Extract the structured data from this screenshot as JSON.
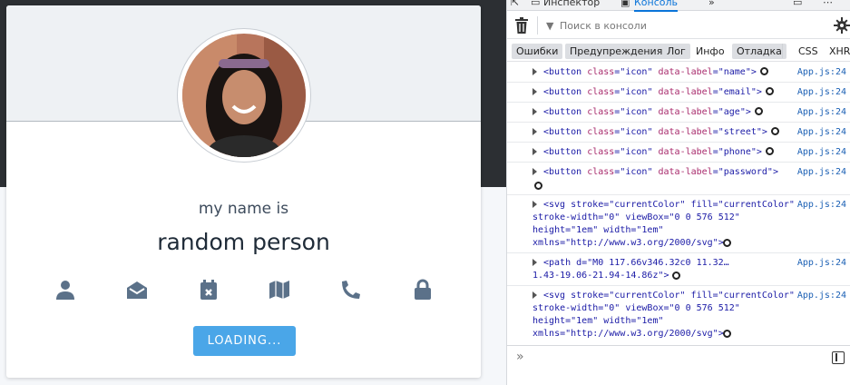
{
  "app": {
    "label": "my name is",
    "value": "random person",
    "loading_label": "LOADING...",
    "icons": [
      "user-icon",
      "envelope-open-icon",
      "calendar-times-icon",
      "map-icon",
      "phone-icon",
      "lock-icon"
    ],
    "icon_color": "#5b7189",
    "accent": "#4aa6e8"
  },
  "devtools": {
    "tabs": [
      "Инспектор",
      "Консоль"
    ],
    "active_tab": "Консоль",
    "filter_placeholder": "Поиск в консоли",
    "filters": [
      "Ошибки",
      "Предупреждения",
      "Лог",
      "Инфо",
      "Отладка",
      "CSS",
      "XHR"
    ],
    "entries": [
      {
        "tag": "button",
        "class": "icon",
        "label": "name",
        "src": "App.js:24"
      },
      {
        "tag": "button",
        "class": "icon",
        "label": "email",
        "src": "App.js:24"
      },
      {
        "tag": "button",
        "class": "icon",
        "label": "age",
        "src": "App.js:24"
      },
      {
        "tag": "button",
        "class": "icon",
        "label": "street",
        "src": "App.js:24"
      },
      {
        "tag": "button",
        "class": "icon",
        "label": "phone",
        "src": "App.js:24"
      },
      {
        "tag": "button",
        "class": "icon",
        "label": "password",
        "src": "App.js:24"
      }
    ],
    "svg_entry_1": {
      "line1": "<svg stroke=\"currentColor\" fill=\"currentColor\"",
      "line2": "stroke-width=\"0\" viewBox=\"0 0 576 512\"",
      "line3": "height=\"1em\" width=\"1em\"",
      "line4": "xmlns=\"http://www.w3.org/2000/svg\">",
      "src": "App.js:24"
    },
    "path_entry": {
      "line1": "<path d=\"M0 117.66v346.32c0 11.32…",
      "line2": "1.43-19.06-21.94-14.86z\">",
      "src": "App.js:24"
    },
    "svg_entry_2": {
      "line1": "<svg stroke=\"currentColor\" fill=\"currentColor\"",
      "line2": "stroke-width=\"0\" viewBox=\"0 0 576 512\"",
      "line3": "height=\"1em\" width=\"1em\"",
      "line4": "xmlns=\"http://www.w3.org/2000/svg\">",
      "src": "App.js:24"
    },
    "prompt": "»"
  }
}
